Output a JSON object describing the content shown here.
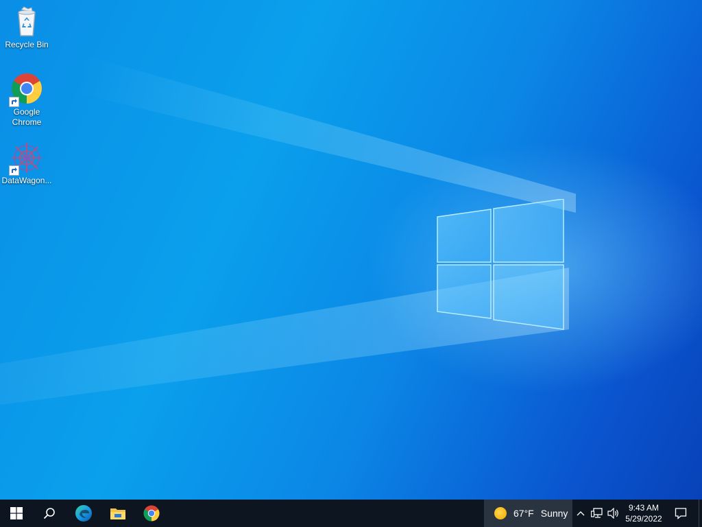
{
  "desktop": {
    "icons": [
      {
        "label": "Recycle Bin",
        "icon": "recycle-bin-icon"
      },
      {
        "label": "Google Chrome",
        "icon": "chrome-icon"
      },
      {
        "label": "DataWagon...",
        "icon": "datawagon-icon"
      }
    ]
  },
  "taskbar": {
    "pinned": [
      {
        "name": "start",
        "icon": "windows-logo-icon"
      },
      {
        "name": "search",
        "icon": "search-icon"
      },
      {
        "name": "edge",
        "icon": "edge-icon"
      },
      {
        "name": "file-explorer",
        "icon": "folder-icon"
      },
      {
        "name": "chrome",
        "icon": "chrome-icon"
      }
    ],
    "weather": {
      "temp": "67°F",
      "condition": "Sunny",
      "icon": "sun-icon"
    },
    "tray": {
      "chevron_icon": "chevron-up-icon",
      "network_icon": "network-icon",
      "volume_icon": "volume-icon"
    },
    "clock": {
      "time": "9:43 AM",
      "date": "5/29/2022"
    },
    "notification_icon": "notification-icon"
  },
  "colors": {
    "desktop_blue": "#0a8ee6",
    "taskbar_bg": "#0d1620",
    "weather_bg": "#2a3340"
  }
}
